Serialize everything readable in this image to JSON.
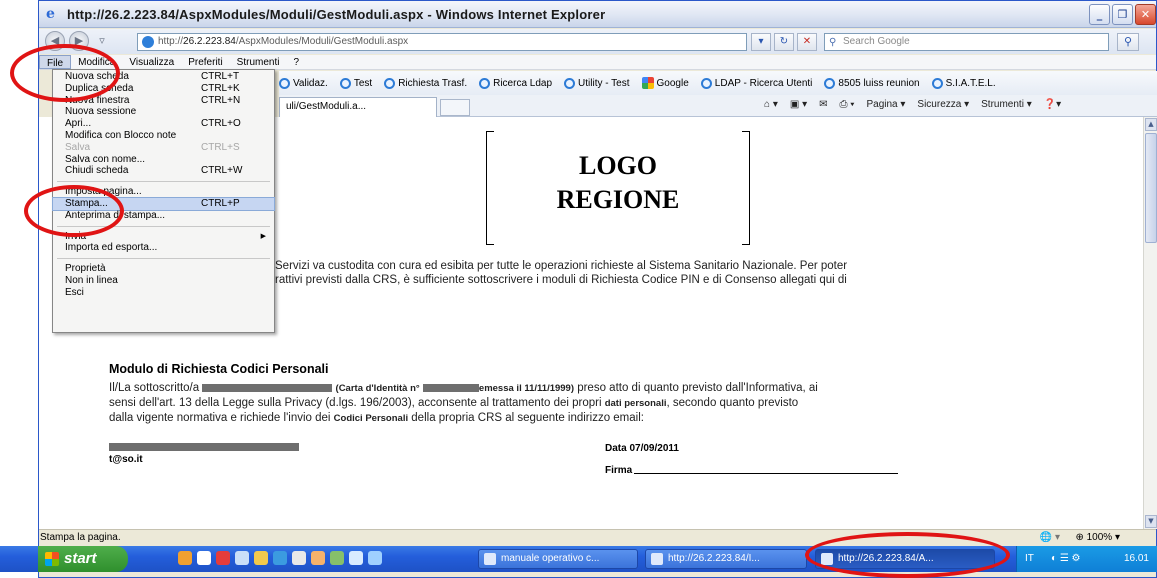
{
  "window": {
    "title": "http://26.2.223.84/AspxModules/Moduli/GestModuli.aspx - Windows Internet Explorer",
    "min": "_",
    "restore": "❐",
    "close": "✕"
  },
  "address": {
    "prefix": "http://",
    "host": "26.2.223.84",
    "path": "/AspxModules/Moduli/GestModuli.aspx",
    "search_placeholder": "Search Google"
  },
  "menubar": [
    "File",
    "Modifica",
    "Visualizza",
    "Preferiti",
    "Strumenti",
    "?"
  ],
  "favorites": [
    "Validaz.",
    "Test",
    "Richiesta Trasf.",
    "Ricerca Ldap",
    "Utility - Test",
    "Google",
    "LDAP - Ricerca Utenti",
    "8505 luiss reunion",
    "S.I.A.T.E.L."
  ],
  "tab": {
    "label": "uli/GestModuli.a..."
  },
  "commands": [
    "Pagina ▾",
    "Sicurezza ▾",
    "Strumenti ▾"
  ],
  "file_menu": [
    {
      "label": "Nuova scheda",
      "shortcut": "CTRL+T"
    },
    {
      "label": "Duplica scheda",
      "shortcut": "CTRL+K"
    },
    {
      "label": "Nuova finestra",
      "shortcut": "CTRL+N"
    },
    {
      "label": "Nuova sessione",
      "shortcut": ""
    },
    {
      "label": "Apri...",
      "shortcut": "CTRL+O"
    },
    {
      "label": "Modifica con Blocco note",
      "shortcut": ""
    },
    {
      "label": "Salva",
      "shortcut": "CTRL+S"
    },
    {
      "label": "Salva con nome...",
      "shortcut": ""
    },
    {
      "label": "Chiudi scheda",
      "shortcut": "CTRL+W"
    },
    {
      "label": "Imposta pagina...",
      "shortcut": ""
    },
    {
      "label": "Stampa...",
      "shortcut": "CTRL+P"
    },
    {
      "label": "Anteprima di stampa...",
      "shortcut": ""
    },
    {
      "label": "Invia",
      "shortcut": ""
    },
    {
      "label": "Importa ed esporta...",
      "shortcut": ""
    },
    {
      "label": "Proprietà",
      "shortcut": ""
    },
    {
      "label": "Non in linea",
      "shortcut": ""
    },
    {
      "label": "Esci",
      "shortcut": ""
    }
  ],
  "document": {
    "logo_line1": "LOGO",
    "logo_line2": "REGIONE",
    "intro_line1": "Servizi va custodita con cura ed esibita per tutte le operazioni richieste al Sistema Sanitario Nazionale. Per poter",
    "intro_line2": "rattivi previsti dalla CRS, è sufficiente sottoscrivere i moduli di Richiesta Codice PIN e di Consenso allegati qui di",
    "module_title": "Modulo di Richiesta Codici Personali",
    "body_a": "Il/La sottoscritto/a",
    "body_b": "(Carta d'Identità n°",
    "body_c": "emessa il 11/11/1999)",
    "body_d": " preso atto di quanto previsto dall'Informativa, ai",
    "body_line2_a": "sensi dell'art. 13 della Legge sulla Privacy (d.lgs. 196/2003), acconsente al trattamento dei propri ",
    "body_line2_b": "dati personali",
    "body_line2_c": ", secondo quanto previsto",
    "body_line3_a": "dalla vigente normativa e richiede l'invio dei ",
    "body_line3_b": "Codici Personali",
    "body_line3_c": " della propria CRS al seguente indirizzo email:",
    "email": "t@so.it",
    "date": "Data 07/09/2011",
    "firma": "Firma"
  },
  "status": {
    "text": "Stampa la pagina.",
    "zoom": "100%"
  },
  "taskbar": {
    "start": "start",
    "tasks": [
      "manuale operativo c...",
      "http://26.2.223.84/I...",
      "http://26.2.223.84/A..."
    ],
    "lang": "IT",
    "clock": "16.01"
  },
  "colors": {
    "callout": "#e01414",
    "titlebar": "#dfe6f3",
    "taskbar": "#245edb"
  }
}
